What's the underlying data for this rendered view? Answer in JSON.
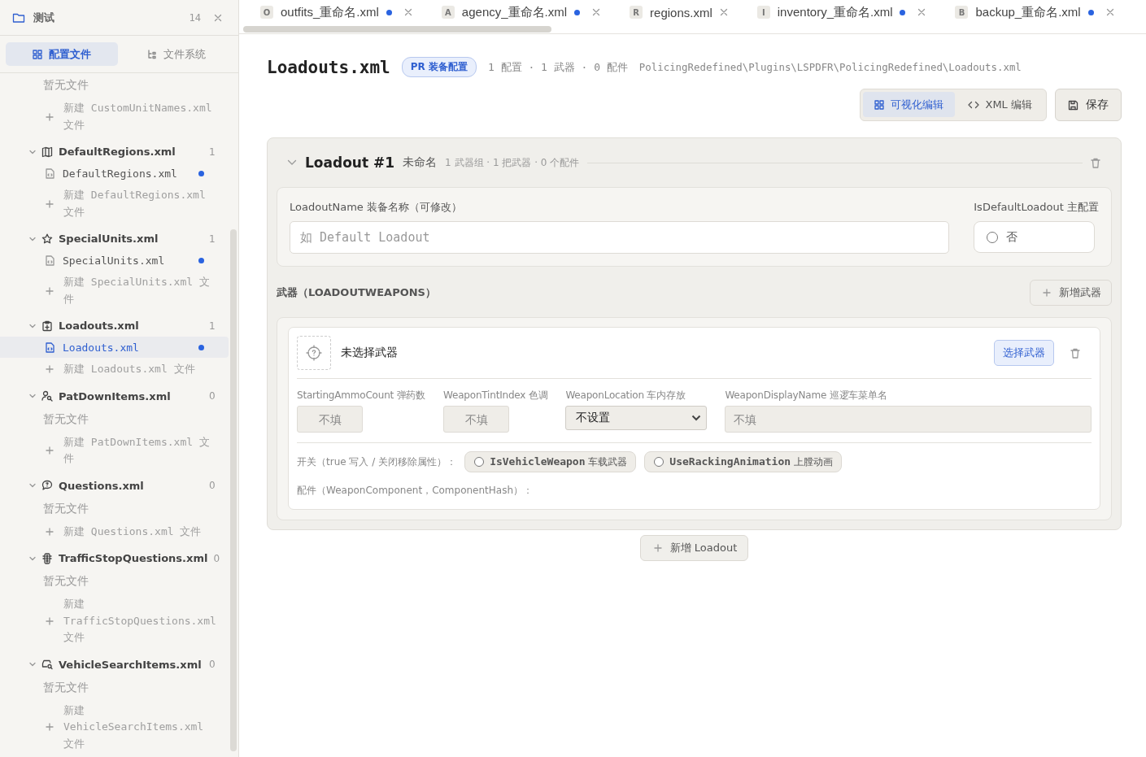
{
  "project": {
    "name": "测试",
    "count": "14"
  },
  "side_tabs": [
    {
      "label": "配置文件",
      "selected": true
    },
    {
      "label": "文件系统",
      "selected": false
    }
  ],
  "tree_top": {
    "empty": "暂无文件",
    "new_file": "新建 CustomUnitNames.xml 文件"
  },
  "groups": [
    {
      "title": "DefaultRegions.xml",
      "count": "1",
      "expanded": true,
      "files": [
        {
          "name": "DefaultRegions.xml",
          "modified": true,
          "selected": false
        }
      ],
      "new_file": "新建 DefaultRegions.xml 文件"
    },
    {
      "title": "SpecialUnits.xml",
      "count": "1",
      "expanded": true,
      "files": [
        {
          "name": "SpecialUnits.xml",
          "modified": true,
          "selected": false
        }
      ],
      "new_file": "新建 SpecialUnits.xml 文件"
    },
    {
      "title": "Loadouts.xml",
      "count": "1",
      "expanded": true,
      "files": [
        {
          "name": "Loadouts.xml",
          "modified": true,
          "selected": true
        }
      ],
      "new_file": "新建 Loadouts.xml 文件"
    },
    {
      "title": "PatDownItems.xml",
      "count": "0",
      "expanded": true,
      "empty": "暂无文件",
      "new_file": "新建 PatDownItems.xml 文件"
    },
    {
      "title": "Questions.xml",
      "count": "0",
      "expanded": true,
      "empty": "暂无文件",
      "new_file": "新建 Questions.xml 文件"
    },
    {
      "title": "TrafficStopQuestions.xml",
      "count": "0",
      "expanded": true,
      "empty": "暂无文件",
      "new_file": "新建 TrafficStopQuestions.xml 文件"
    },
    {
      "title": "VehicleSearchItems.xml",
      "count": "0",
      "expanded": true,
      "empty": "暂无文件",
      "new_file": "新建 VehicleSearchItems.xml 文件"
    }
  ],
  "tabs": [
    {
      "letter": "O",
      "label": "outfits_重命名.xml",
      "modified": true
    },
    {
      "letter": "A",
      "label": "agency_重命名.xml",
      "modified": true
    },
    {
      "letter": "R",
      "label": "regions.xml",
      "modified": false
    },
    {
      "letter": "I",
      "label": "inventory_重命名.xml",
      "modified": true
    },
    {
      "letter": "B",
      "label": "backup_重命名.xml",
      "modified": true
    }
  ],
  "header": {
    "title": "Loadouts.xml",
    "badge": "PR 装备配置",
    "stats": "1 配置 · 1 武器 · 0 配件",
    "path": "PolicingRedefined\\Plugins\\LSPDFR\\PolicingRedefined\\Loadouts.xml"
  },
  "view_modes": [
    {
      "label": "可视化编辑",
      "selected": true
    },
    {
      "label": "XML 编辑",
      "selected": false
    }
  ],
  "save_button": "保存",
  "loadout": {
    "expanded": true,
    "title": "Loadout #1",
    "name": "未命名",
    "summary": "1 武器组 · 1 把武器 · 0 个配件",
    "name_field": {
      "label": "LoadoutName 装备名称（可修改）",
      "placeholder": "如 Default Loadout"
    },
    "default_field": {
      "label": "IsDefaultLoadout 主配置",
      "checked": false,
      "text": "否"
    },
    "weapons_title": "武器（LOADOUTWEAPONS）",
    "add_weapon": "新增武器",
    "weapon": {
      "name": "未选择武器",
      "select_button": "选择武器",
      "fields": [
        {
          "kind": "input",
          "label": "StartingAmmoCount 弹药数",
          "placeholder": "不填"
        },
        {
          "kind": "input",
          "label": "WeaponTintIndex 色调",
          "placeholder": "不填"
        },
        {
          "kind": "select",
          "label": "WeaponLocation 车内存放",
          "value": "不设置"
        },
        {
          "kind": "wide",
          "label": "WeaponDisplayName 巡逻车菜单名",
          "placeholder": "不填"
        }
      ],
      "switch_label": "开关（true 写入 / 关闭移除属性）：",
      "switches": [
        {
          "code": "IsVehicleWeapon",
          "note": "车载武器",
          "on": false
        },
        {
          "code": "UseRackingAnimation",
          "note": "上膛动画",
          "on": false
        }
      ],
      "components_label": "配件（WeaponComponent，ComponentHash）："
    }
  },
  "add_loadout": "新增 Loadout"
}
